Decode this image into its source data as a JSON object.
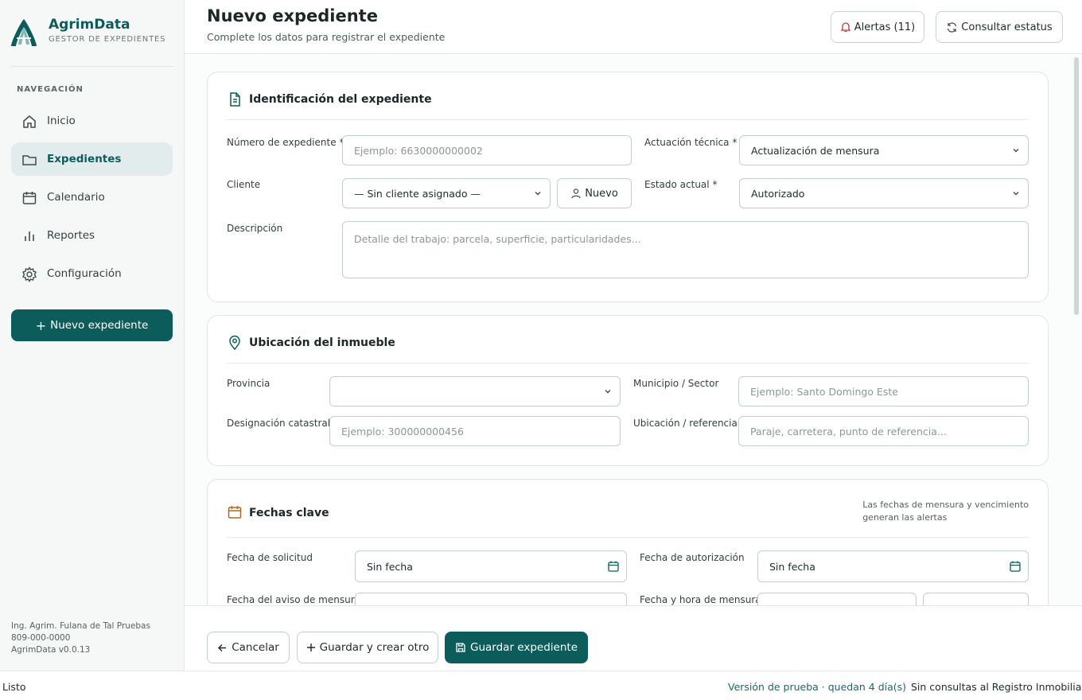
{
  "brand": {
    "name": "AgrimData",
    "subtitle": "GESTOR DE EXPEDIENTES"
  },
  "nav": {
    "heading": "NAVEGACIÓN",
    "items": [
      {
        "label": "Inicio",
        "icon": "home-icon"
      },
      {
        "label": "Expedientes",
        "icon": "folder-icon",
        "active": true
      },
      {
        "label": "Calendario",
        "icon": "calendar-icon"
      },
      {
        "label": "Reportes",
        "icon": "bar-chart-icon"
      },
      {
        "label": "Configuración",
        "icon": "gear-icon"
      }
    ],
    "new_button": "Nuevo expediente"
  },
  "user": {
    "name": "Ing. Agrim. Fulana de Tal Pruebas",
    "phone": "809-000-0000",
    "version": "AgrimData v0.0.13"
  },
  "header": {
    "title": "Nuevo expediente",
    "subtitle": "Complete los datos para registrar el expediente",
    "alerts_button": "Alertas (11)",
    "status_button": "Consultar estatus"
  },
  "identificacion": {
    "title": "Identificación del expediente",
    "numero_label": "Número de expediente",
    "numero_placeholder": "Ejemplo: 6630000000002",
    "actuacion_label": "Actuación técnica",
    "actuacion_value": "Actualización de mensura",
    "cliente_label": "Cliente",
    "cliente_value": "— Sin cliente asignado —",
    "nuevo_cliente_button": "Nuevo",
    "estado_label": "Estado actual",
    "estado_value": "Autorizado",
    "descripcion_label": "Descripción",
    "descripcion_placeholder": "Detalle del trabajo: parcela, superficie, particularidades..."
  },
  "ubicacion": {
    "title": "Ubicación del inmueble",
    "provincia_label": "Provincia",
    "provincia_value": "",
    "municipio_label": "Municipio / Sector",
    "municipio_placeholder": "Ejemplo: Santo Domingo Este",
    "designacion_label": "Designación catastral",
    "designacion_placeholder": "Ejemplo: 300000000456",
    "referencia_label": "Ubicación / referencia",
    "referencia_placeholder": "Paraje, carretera, punto de referencia..."
  },
  "fechas": {
    "title": "Fechas clave",
    "note_line1": "Las fechas de mensura y vencimiento",
    "note_line2": "generan las alertas",
    "solicitud_label": "Fecha de solicitud",
    "solicitud_value": "Sin fecha",
    "autorizacion_label": "Fecha de autorización",
    "autorizacion_value": "Sin fecha",
    "aviso_label": "Fecha del aviso de mensura",
    "mensura_label": "Fecha y hora de mensura"
  },
  "footer": {
    "cancel": "Cancelar",
    "save_new": "Guardar y crear otro",
    "save": "Guardar expediente"
  },
  "statusbar": {
    "left": "Listo",
    "trial": "Versión de prueba · quedan 4 día(s)",
    "registry": "Sin consultas al Registro Inmobiliario"
  },
  "colors": {
    "accent": "#0d5c5c",
    "alert_icon": "#c0392b",
    "date_icon": "#b5671b"
  }
}
